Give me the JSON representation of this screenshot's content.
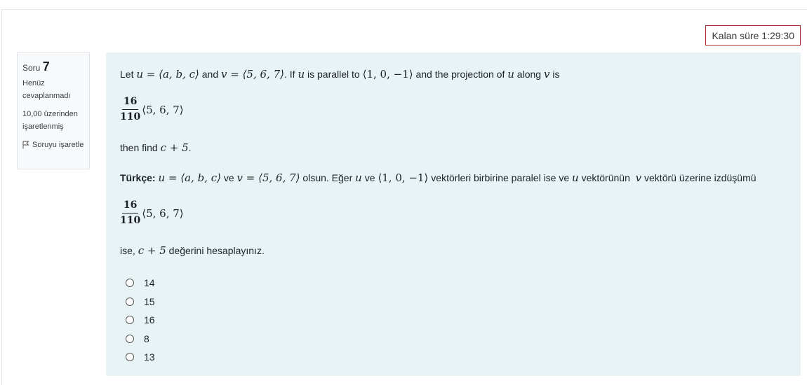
{
  "timer": {
    "text": "Kalan süre 1:29:30"
  },
  "info": {
    "question_label": "Soru",
    "question_number": "7",
    "state": "Henüz cevaplanmadı",
    "grade": "10,00 üzerinden işaretlenmiş",
    "flag_label": "Soruyu işaretle"
  },
  "question": {
    "en": {
      "t1": "Let ",
      "m1": "u = ⟨a, b, c⟩",
      "t2": " and ",
      "m2": "v = ⟨5, 6, 7⟩",
      "t3": ". If ",
      "m3": "u",
      "t4": " is parallel to ",
      "m4": "⟨1, 0, −1⟩",
      "t5": " and the projection of ",
      "m5": "u",
      "t6": " along ",
      "m6": "v",
      "t7": " is"
    },
    "fraction": {
      "numerator": "16",
      "denominator": "110",
      "vector": "⟨5, 6, 7⟩"
    },
    "en_find": {
      "t1": "then find ",
      "m1": "c + 5",
      "t2": "."
    },
    "tr": {
      "label": "Türkçe:",
      "m1": "u = ⟨a, b, c⟩",
      "t1": " ve ",
      "m2": "v = ⟨5, 6, 7⟩",
      "t2": " olsun. Eğer ",
      "m3": "u",
      "t3": " ve ",
      "m4": "⟨1, 0, −1⟩",
      "t4": " vektörleri birbirine paralel ise ve ",
      "m5": "u",
      "t5": " vektörünün  ",
      "m6": "v",
      "t6": " vektörü üzerine izdüşümü"
    },
    "tr_find": {
      "t1": "ise, ",
      "m1": "c + 5",
      "t2": " değerini hesaplayınız."
    }
  },
  "options": [
    "14",
    "15",
    "16",
    "8",
    "13"
  ]
}
